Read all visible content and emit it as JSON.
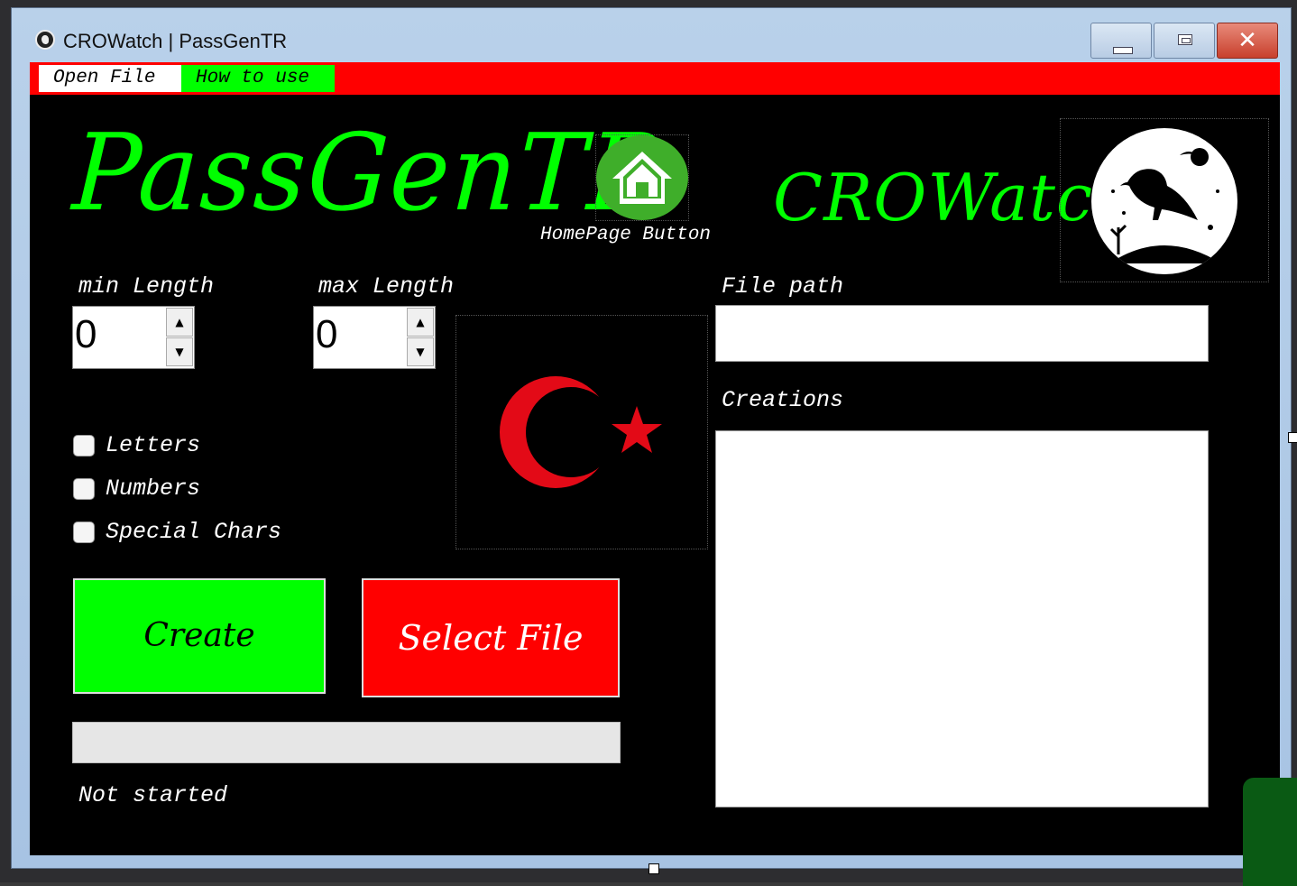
{
  "window": {
    "title": "CROWatch | PassGenTR",
    "controls": {
      "minimize": "minimize",
      "maximize": "maximize",
      "close": "✕"
    }
  },
  "menu": {
    "items": [
      "Open File",
      "How to use"
    ]
  },
  "header": {
    "brand_left": "PassGenTR",
    "home_label": "HomePage Button",
    "brand_right": "CROWatch"
  },
  "form": {
    "min_label": "min Length",
    "min_value": "0",
    "max_label": "max Length",
    "max_value": "0",
    "options": [
      {
        "label": "Letters",
        "checked": false
      },
      {
        "label": "Numbers",
        "checked": false
      },
      {
        "label": "Special Chars",
        "checked": false
      }
    ],
    "create_label": "Create",
    "select_label": "Select File",
    "progress_fraction": 0,
    "status": "Not started"
  },
  "right": {
    "file_path_label": "File path",
    "file_path_value": "",
    "creations_label": "Creations",
    "creations": []
  },
  "colors": {
    "menu_bar": "#ff0000",
    "accent_green": "#00ff00",
    "accent_red": "#ff0000",
    "background": "#000000",
    "flag_red": "#e30a17"
  },
  "icons": [
    "app-crow-icon",
    "home-icon",
    "crow-logo",
    "turkish-flag"
  ]
}
